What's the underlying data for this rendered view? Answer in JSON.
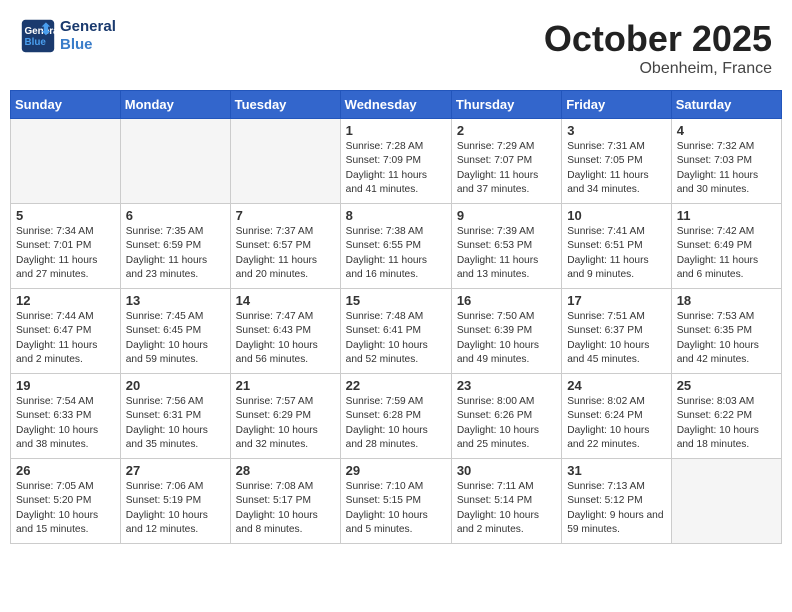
{
  "header": {
    "logo_line1": "General",
    "logo_line2": "Blue",
    "month": "October 2025",
    "location": "Obenheim, France"
  },
  "weekdays": [
    "Sunday",
    "Monday",
    "Tuesday",
    "Wednesday",
    "Thursday",
    "Friday",
    "Saturday"
  ],
  "weeks": [
    [
      {
        "day": "",
        "info": ""
      },
      {
        "day": "",
        "info": ""
      },
      {
        "day": "",
        "info": ""
      },
      {
        "day": "1",
        "info": "Sunrise: 7:28 AM\nSunset: 7:09 PM\nDaylight: 11 hours and 41 minutes."
      },
      {
        "day": "2",
        "info": "Sunrise: 7:29 AM\nSunset: 7:07 PM\nDaylight: 11 hours and 37 minutes."
      },
      {
        "day": "3",
        "info": "Sunrise: 7:31 AM\nSunset: 7:05 PM\nDaylight: 11 hours and 34 minutes."
      },
      {
        "day": "4",
        "info": "Sunrise: 7:32 AM\nSunset: 7:03 PM\nDaylight: 11 hours and 30 minutes."
      }
    ],
    [
      {
        "day": "5",
        "info": "Sunrise: 7:34 AM\nSunset: 7:01 PM\nDaylight: 11 hours and 27 minutes."
      },
      {
        "day": "6",
        "info": "Sunrise: 7:35 AM\nSunset: 6:59 PM\nDaylight: 11 hours and 23 minutes."
      },
      {
        "day": "7",
        "info": "Sunrise: 7:37 AM\nSunset: 6:57 PM\nDaylight: 11 hours and 20 minutes."
      },
      {
        "day": "8",
        "info": "Sunrise: 7:38 AM\nSunset: 6:55 PM\nDaylight: 11 hours and 16 minutes."
      },
      {
        "day": "9",
        "info": "Sunrise: 7:39 AM\nSunset: 6:53 PM\nDaylight: 11 hours and 13 minutes."
      },
      {
        "day": "10",
        "info": "Sunrise: 7:41 AM\nSunset: 6:51 PM\nDaylight: 11 hours and 9 minutes."
      },
      {
        "day": "11",
        "info": "Sunrise: 7:42 AM\nSunset: 6:49 PM\nDaylight: 11 hours and 6 minutes."
      }
    ],
    [
      {
        "day": "12",
        "info": "Sunrise: 7:44 AM\nSunset: 6:47 PM\nDaylight: 11 hours and 2 minutes."
      },
      {
        "day": "13",
        "info": "Sunrise: 7:45 AM\nSunset: 6:45 PM\nDaylight: 10 hours and 59 minutes."
      },
      {
        "day": "14",
        "info": "Sunrise: 7:47 AM\nSunset: 6:43 PM\nDaylight: 10 hours and 56 minutes."
      },
      {
        "day": "15",
        "info": "Sunrise: 7:48 AM\nSunset: 6:41 PM\nDaylight: 10 hours and 52 minutes."
      },
      {
        "day": "16",
        "info": "Sunrise: 7:50 AM\nSunset: 6:39 PM\nDaylight: 10 hours and 49 minutes."
      },
      {
        "day": "17",
        "info": "Sunrise: 7:51 AM\nSunset: 6:37 PM\nDaylight: 10 hours and 45 minutes."
      },
      {
        "day": "18",
        "info": "Sunrise: 7:53 AM\nSunset: 6:35 PM\nDaylight: 10 hours and 42 minutes."
      }
    ],
    [
      {
        "day": "19",
        "info": "Sunrise: 7:54 AM\nSunset: 6:33 PM\nDaylight: 10 hours and 38 minutes."
      },
      {
        "day": "20",
        "info": "Sunrise: 7:56 AM\nSunset: 6:31 PM\nDaylight: 10 hours and 35 minutes."
      },
      {
        "day": "21",
        "info": "Sunrise: 7:57 AM\nSunset: 6:29 PM\nDaylight: 10 hours and 32 minutes."
      },
      {
        "day": "22",
        "info": "Sunrise: 7:59 AM\nSunset: 6:28 PM\nDaylight: 10 hours and 28 minutes."
      },
      {
        "day": "23",
        "info": "Sunrise: 8:00 AM\nSunset: 6:26 PM\nDaylight: 10 hours and 25 minutes."
      },
      {
        "day": "24",
        "info": "Sunrise: 8:02 AM\nSunset: 6:24 PM\nDaylight: 10 hours and 22 minutes."
      },
      {
        "day": "25",
        "info": "Sunrise: 8:03 AM\nSunset: 6:22 PM\nDaylight: 10 hours and 18 minutes."
      }
    ],
    [
      {
        "day": "26",
        "info": "Sunrise: 7:05 AM\nSunset: 5:20 PM\nDaylight: 10 hours and 15 minutes."
      },
      {
        "day": "27",
        "info": "Sunrise: 7:06 AM\nSunset: 5:19 PM\nDaylight: 10 hours and 12 minutes."
      },
      {
        "day": "28",
        "info": "Sunrise: 7:08 AM\nSunset: 5:17 PM\nDaylight: 10 hours and 8 minutes."
      },
      {
        "day": "29",
        "info": "Sunrise: 7:10 AM\nSunset: 5:15 PM\nDaylight: 10 hours and 5 minutes."
      },
      {
        "day": "30",
        "info": "Sunrise: 7:11 AM\nSunset: 5:14 PM\nDaylight: 10 hours and 2 minutes."
      },
      {
        "day": "31",
        "info": "Sunrise: 7:13 AM\nSunset: 5:12 PM\nDaylight: 9 hours and 59 minutes."
      },
      {
        "day": "",
        "info": ""
      }
    ]
  ]
}
